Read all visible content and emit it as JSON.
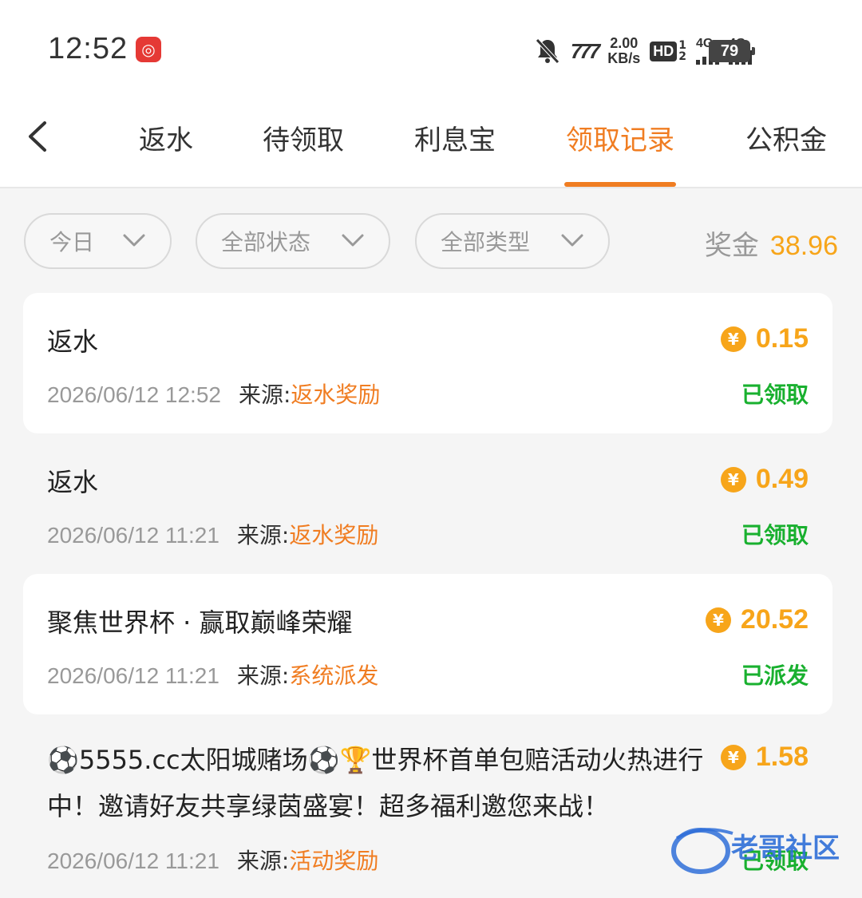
{
  "status_bar": {
    "time": "12:52",
    "app_icon": "netease-music-icon",
    "nfc_label": "777",
    "speed_value": "2.00",
    "speed_unit": "KB/s",
    "hd_label": "HD",
    "hd_slot1": "1",
    "hd_slot2": "2",
    "network1": "4G",
    "network2": "4G",
    "battery": "79"
  },
  "nav": {
    "back_icon": "chevron-left-icon",
    "tabs": [
      {
        "label": "返水",
        "active": false
      },
      {
        "label": "待领取",
        "active": false
      },
      {
        "label": "利息宝",
        "active": false
      },
      {
        "label": "领取记录",
        "active": true
      },
      {
        "label": "公积金",
        "active": false
      }
    ]
  },
  "filters": {
    "date": "今日",
    "status": "全部状态",
    "type": "全部类型"
  },
  "bonus": {
    "label": "奖金",
    "value": "38.96"
  },
  "records": [
    {
      "title": "返水",
      "amount": "0.15",
      "date": "2026/06/12 12:52",
      "source_label": "来源:",
      "source": "返水奖励",
      "status": "已领取"
    },
    {
      "title": "返水",
      "amount": "0.49",
      "date": "2026/06/12 11:21",
      "source_label": "来源:",
      "source": "返水奖励",
      "status": "已领取"
    },
    {
      "title": "聚焦世界杯 · 赢取巅峰荣耀",
      "amount": "20.52",
      "date": "2026/06/12 11:21",
      "source_label": "来源:",
      "source": "系统派发",
      "status": "已派发"
    },
    {
      "title": "⚽5555.cc太阳城赌场⚽🏆世界杯首单包赔活动火热进行中！邀请好友共享绿茵盛宴！超多福利邀您来战！",
      "amount": "1.58",
      "date": "2026/06/12 11:21",
      "source_label": "来源:",
      "source": "活动奖励",
      "status": "已领取"
    }
  ],
  "coin_symbol": "¥",
  "watermark": {
    "text": "老哥社区"
  },
  "colors": {
    "accent": "#f07d22",
    "gold": "#f7a51a",
    "success": "#19b02f"
  }
}
